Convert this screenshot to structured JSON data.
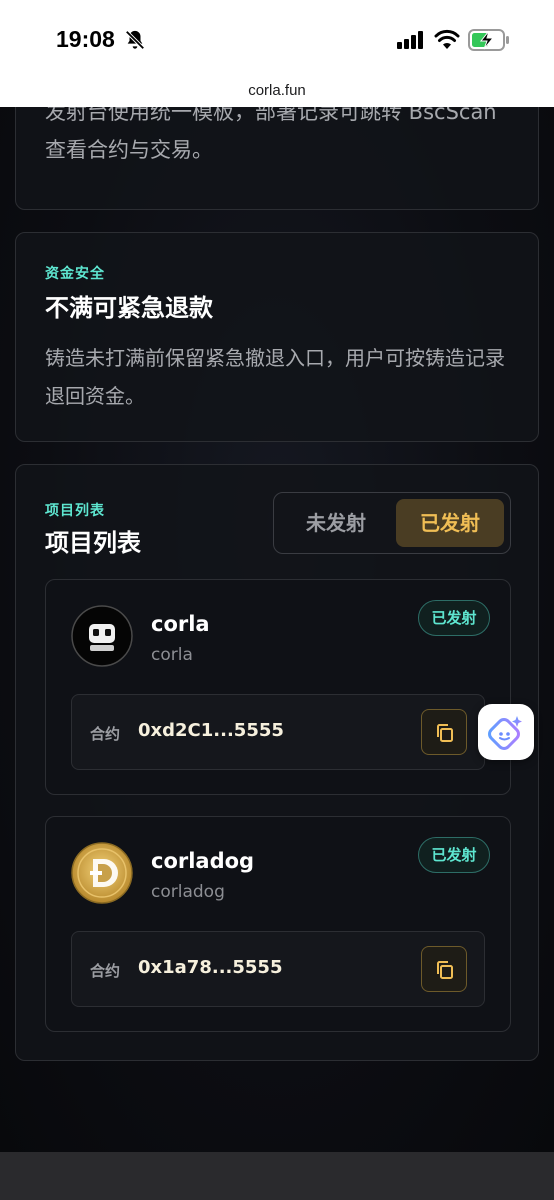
{
  "status_bar": {
    "time": "19:08"
  },
  "browser": {
    "url": "corla.fun"
  },
  "template_card": {
    "text": "发射台使用统一模板，部署记录可跳转 BscScan 查看合约与交易。"
  },
  "safety_card": {
    "eyebrow": "资金安全",
    "title": "不满可紧急退款",
    "text": "铸造未打满前保留紧急撤退入口，用户可按铸造记录退回资金。"
  },
  "projects": {
    "eyebrow": "项目列表",
    "title": "项目列表",
    "tabs": [
      {
        "label": "未发射",
        "active": false
      },
      {
        "label": "已发射",
        "active": true
      }
    ],
    "items": [
      {
        "name": "corla",
        "subtitle": "corla",
        "status": "已发射",
        "contract_label": "合约",
        "contract_address": "0xd2C1...5555",
        "avatar": "robot-avatar"
      },
      {
        "name": "corladog",
        "subtitle": "corladog",
        "status": "已发射",
        "contract_label": "合约",
        "contract_address": "0x1a78...5555",
        "avatar": "doge-avatar"
      }
    ]
  },
  "colors": {
    "accent_teal": "#5ee6d0",
    "accent_gold": "#f0be55",
    "background": "#0b0c10"
  }
}
